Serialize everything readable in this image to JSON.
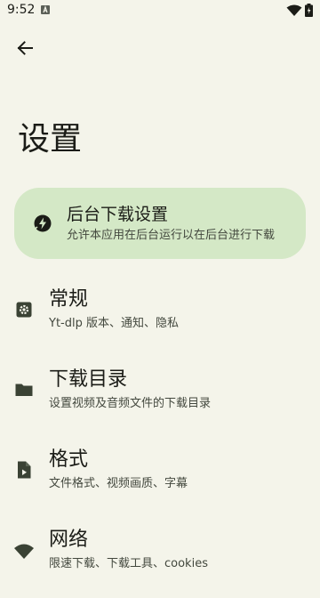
{
  "status": {
    "time": "9:52"
  },
  "page": {
    "title": "设置"
  },
  "background_card": {
    "title": "后台下载设置",
    "subtitle": "允许本应用在后台运行以在后台进行下载",
    "icon": "bolt-icon",
    "background": "#d4e8c6"
  },
  "items": [
    {
      "title": "常规",
      "subtitle": "Yt-dlp 版本、通知、隐私",
      "icon": "gear-icon"
    },
    {
      "title": "下载目录",
      "subtitle": "设置视频及音频文件的下载目录",
      "icon": "folder-icon"
    },
    {
      "title": "格式",
      "subtitle": "文件格式、视频画质、字幕",
      "icon": "file-video-icon"
    },
    {
      "title": "网络",
      "subtitle": "限速下载、下载工具、cookies",
      "icon": "wifi-icon"
    }
  ],
  "colors": {
    "background": "#f4f4ea",
    "text": "#1b1c17",
    "secondary_text": "#43483e",
    "icon": "#3a4234"
  }
}
